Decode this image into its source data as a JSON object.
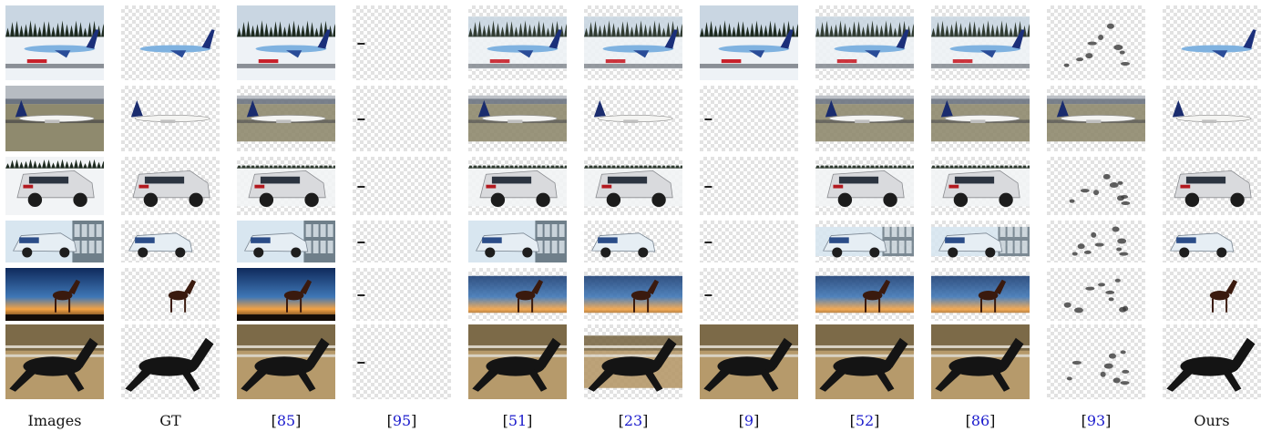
{
  "figure": {
    "columns": [
      {
        "label": "Images",
        "kind": "text"
      },
      {
        "label": "GT",
        "kind": "text"
      },
      {
        "label": "85",
        "kind": "cite"
      },
      {
        "label": "95",
        "kind": "cite"
      },
      {
        "label": "51",
        "kind": "cite"
      },
      {
        "label": "23",
        "kind": "cite"
      },
      {
        "label": "9",
        "kind": "cite"
      },
      {
        "label": "52",
        "kind": "cite"
      },
      {
        "label": "86",
        "kind": "cite"
      },
      {
        "label": "93",
        "kind": "cite"
      },
      {
        "label": "Ours",
        "kind": "text"
      }
    ],
    "rows": [
      {
        "subject": "airplane-blue",
        "scene": "snowy-runway"
      },
      {
        "subject": "airplane-white",
        "scene": "grass-runway"
      },
      {
        "subject": "car-silver-suv",
        "scene": "snow"
      },
      {
        "subject": "car-white-sedan",
        "scene": "showroom"
      },
      {
        "subject": "horse-silhouette",
        "scene": "sunset"
      },
      {
        "subject": "horse-black",
        "scene": "field"
      }
    ],
    "colors": {
      "checker": "#e2e2e2",
      "citation": "#1a1acc",
      "text": "#111111"
    }
  }
}
